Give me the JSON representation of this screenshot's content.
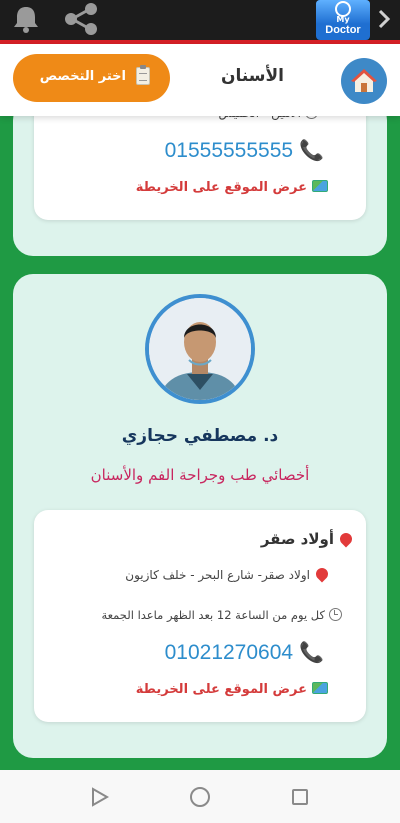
{
  "app": {
    "logo_my": "My",
    "logo_doctor": "Doctor"
  },
  "header": {
    "title": "الأسنان",
    "specialty_button": "اختر التخصص"
  },
  "cards": [
    {
      "hours": "الاثنين - الخميس",
      "phone": "01555555555",
      "map_link": "عرض الموقع على الخريطة"
    },
    {
      "doctor_name": "د. مصطفي حجازي",
      "specialty": "أخصائي طب وجراحة الفم والأسنان",
      "location_title": "أولاد صقر",
      "address": "اولاد صقر- شارع البحر - خلف كازيون",
      "hours": "كل يوم من الساعة 12 بعد الظهر ماعدا الجمعة",
      "phone": "01021270604",
      "map_link": "عرض الموقع على الخريطة"
    }
  ],
  "icons": {
    "status": [
      "bell-icon",
      "share-icon",
      "chevron-right-icon"
    ],
    "header": [
      "home-icon",
      "clipboard-icon"
    ],
    "nav": [
      "back-triangle-icon",
      "home-circle-icon",
      "recent-square-icon"
    ]
  },
  "colors": {
    "background_green": "#1f9a44",
    "card_bg": "#ddf3ec",
    "accent_orange": "#ef8a17",
    "home_blue": "#3e89c7",
    "phone_blue": "#2d8dcc",
    "map_red": "#d43b3b",
    "specialty_pink": "#c8265f",
    "status_red_line": "#d62026"
  }
}
